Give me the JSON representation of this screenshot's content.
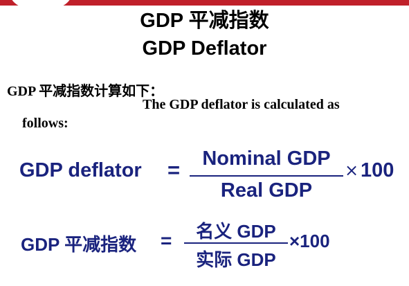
{
  "slide": {
    "title_cn": "GDP 平减指数",
    "title_en": "GDP Deflator",
    "intro_cn": "GDP 平减指数计算如下：",
    "intro_en_line1": "The GDP deflator is calculated as",
    "intro_en_line2": "follows:"
  },
  "formula_en": {
    "lhs": "GDP deflator",
    "equals": "=",
    "numerator": "Nominal GDP",
    "denominator": "Real GDP",
    "times": "×",
    "multiplier": "100"
  },
  "formula_cn": {
    "lhs": "GDP 平减指数",
    "equals": "=",
    "numerator": "名义 GDP",
    "denominator": "实际 GDP",
    "times_multiplier": "×100"
  },
  "colors": {
    "formula_text": "#1a237e",
    "top_stripe": "#c0202a"
  }
}
